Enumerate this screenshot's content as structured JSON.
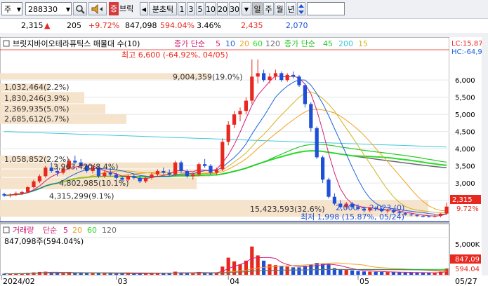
{
  "toolbar": {
    "market_label": "주",
    "code": "288330",
    "search_icon": "search-icon",
    "speaker_icon": "speaker-icon",
    "tags": {
      "jeung": "증",
      "brick": "브릭"
    },
    "minute_tick_label": "분초틱",
    "periods": [
      "1",
      "3",
      "5",
      "10",
      "20",
      "30"
    ],
    "dropdown_icon": "chevron-down-icon",
    "day_label": "일",
    "week_label": "주",
    "month_label": "월",
    "year_label": "년",
    "arrows_icon": "updown-arrows-icon"
  },
  "quote": {
    "price": "2,315",
    "change_arrow": "▲",
    "change": "205",
    "change_pct": "+9.72%",
    "volume": "847,098",
    "volume_ratio": "594.04%",
    "turnover_pct": "3.46%",
    "high": "2,435",
    "low": "2,070"
  },
  "legend": {
    "title": "브릿지바이오테라퓨틱스 매물대 수(10)",
    "ma_label": "종가 단순",
    "ma_periods": [
      "5",
      "10",
      "20",
      "60",
      "120"
    ],
    "ma_label2": "종가 단순",
    "ma_periods2": [
      "45",
      "200",
      "15"
    ],
    "lc_label": "LC:15,87",
    "hc_label": "HC:-64,9"
  },
  "annotations": {
    "high": "최고 6,600 (-64.92%, 04/05)",
    "low": "최저 1,998 (15.87%, 05/24)",
    "range": "2,000 ~ 2,023 (0)",
    "current_price_tag": "2,315",
    "current_pct_tag": "9.72%",
    "volume_tag": "847,09",
    "volume_pct_tag": "594.04"
  },
  "volume_profile": [
    {
      "label": "9,004,359(19.0%)"
    },
    {
      "label": "1,032,464(2.2%)"
    },
    {
      "label": "1,830,246(3.9%)"
    },
    {
      "label": "2,369,935(5.0%)"
    },
    {
      "label": "2,685,612(5.7%)"
    },
    {
      "label": "1,058,852(2.2%)"
    },
    {
      "label": "3,963,420(8.4%)"
    },
    {
      "label": "4,802,985(10.1%)"
    },
    {
      "label": "4,315,299(9.1%)"
    },
    {
      "label": "15,423,593(32.6%)"
    }
  ],
  "price_axis": [
    "6,000",
    "5,500",
    "5,000",
    "4,500",
    "4,000",
    "3,500",
    "3,000",
    "2,500"
  ],
  "volume_pane": {
    "title": "거래량",
    "ma_label": "단순",
    "ma_periods": [
      "5",
      "20",
      "60",
      "120"
    ],
    "current": "847,098주(594.04%)",
    "axis": [
      "5,000K"
    ]
  },
  "date_axis": [
    "2024/02",
    "03",
    "04",
    "05",
    "05/27"
  ],
  "colors": {
    "up": "#e8281e",
    "down": "#1e4fd8",
    "ma5": "#d21e78",
    "ma10": "#1e64dc",
    "ma20": "#f0a01e",
    "ma60": "#2adc2a",
    "ma120": "#6a6a6a",
    "ma45": "#28c828",
    "ma200": "#3cc8dc",
    "ma15": "#d2b41e",
    "profile": "#f5e2c8"
  },
  "chart_data": {
    "type": "candlestick",
    "dates": [
      "02/01",
      "02/02",
      "02/05",
      "02/06",
      "02/07",
      "02/08",
      "02/13",
      "02/14",
      "02/15",
      "02/16",
      "02/19",
      "02/20",
      "02/21",
      "02/22",
      "02/23",
      "02/26",
      "02/27",
      "02/28",
      "02/29",
      "03/04",
      "03/05",
      "03/06",
      "03/07",
      "03/08",
      "03/11",
      "03/12",
      "03/13",
      "03/14",
      "03/15",
      "03/18",
      "03/19",
      "03/20",
      "03/21",
      "03/22",
      "03/25",
      "03/26",
      "03/27",
      "03/28",
      "03/29",
      "04/01",
      "04/02",
      "04/03",
      "04/04",
      "04/05",
      "04/08",
      "04/09",
      "04/11",
      "04/12",
      "04/15",
      "04/16",
      "04/17",
      "04/18",
      "04/19",
      "04/22",
      "04/23",
      "04/24",
      "04/25",
      "04/26",
      "04/29",
      "04/30",
      "05/02",
      "05/03",
      "05/07",
      "05/08",
      "05/09",
      "05/10",
      "05/13",
      "05/14",
      "05/16",
      "05/17",
      "05/20",
      "05/21",
      "05/22",
      "05/23",
      "05/24",
      "05/27"
    ],
    "ohlc": [
      [
        2680,
        2720,
        2600,
        2640
      ],
      [
        2640,
        2700,
        2580,
        2660
      ],
      [
        2660,
        2750,
        2620,
        2700
      ],
      [
        2700,
        2780,
        2650,
        2740
      ],
      [
        2740,
        2900,
        2700,
        2880
      ],
      [
        2880,
        3100,
        2850,
        3050
      ],
      [
        3050,
        3250,
        3000,
        3200
      ],
      [
        3200,
        3500,
        3150,
        3450
      ],
      [
        3450,
        3600,
        3300,
        3350
      ],
      [
        3350,
        3500,
        3200,
        3300
      ],
      [
        3300,
        3480,
        3250,
        3420
      ],
      [
        3420,
        3700,
        3380,
        3650
      ],
      [
        3650,
        3800,
        3550,
        3600
      ],
      [
        3600,
        3700,
        3450,
        3500
      ],
      [
        3500,
        3550,
        3300,
        3350
      ],
      [
        3350,
        3500,
        3280,
        3450
      ],
      [
        3450,
        3480,
        3150,
        3200
      ],
      [
        3200,
        3350,
        3150,
        3300
      ],
      [
        3300,
        3420,
        3200,
        3250
      ],
      [
        3250,
        3300,
        3100,
        3150
      ],
      [
        3150,
        3200,
        3050,
        3100
      ],
      [
        3100,
        3250,
        3050,
        3200
      ],
      [
        3200,
        3280,
        3100,
        3150
      ],
      [
        3150,
        3200,
        3000,
        3050
      ],
      [
        3050,
        3180,
        3000,
        3150
      ],
      [
        3150,
        3300,
        3100,
        3250
      ],
      [
        3250,
        3400,
        3200,
        3350
      ],
      [
        3350,
        3450,
        3250,
        3300
      ],
      [
        3300,
        3400,
        3200,
        3250
      ],
      [
        3250,
        3650,
        3200,
        3600
      ],
      [
        3600,
        3650,
        3300,
        3350
      ],
      [
        3350,
        3400,
        3150,
        3200
      ],
      [
        3200,
        3300,
        3100,
        3250
      ],
      [
        3250,
        3600,
        3200,
        3550
      ],
      [
        3550,
        3700,
        3450,
        3500
      ],
      [
        3500,
        3550,
        3250,
        3300
      ],
      [
        3300,
        3450,
        3250,
        3400
      ],
      [
        3400,
        4300,
        3350,
        4200
      ],
      [
        4200,
        4800,
        4100,
        4700
      ],
      [
        4700,
        5100,
        4600,
        5000
      ],
      [
        5000,
        5200,
        4800,
        5100
      ],
      [
        5100,
        5500,
        5000,
        5400
      ],
      [
        5400,
        6600,
        5300,
        6100
      ],
      [
        6100,
        6600,
        5900,
        6200
      ],
      [
        6200,
        6300,
        5950,
        6000
      ],
      [
        6000,
        6200,
        5900,
        6100
      ],
      [
        6100,
        6300,
        6000,
        6200
      ],
      [
        6200,
        6250,
        5950,
        6000
      ],
      [
        6000,
        6200,
        5950,
        6150
      ],
      [
        6150,
        6250,
        6050,
        6100
      ],
      [
        6100,
        6150,
        5800,
        5850
      ],
      [
        5850,
        5900,
        5200,
        5300
      ],
      [
        5300,
        5350,
        4500,
        4600
      ],
      [
        4600,
        4650,
        3700,
        3750
      ],
      [
        3750,
        3800,
        3000,
        3100
      ],
      [
        3100,
        3150,
        2550,
        2600
      ],
      [
        2600,
        2700,
        2350,
        2400
      ],
      [
        2400,
        2500,
        2250,
        2300
      ],
      [
        2300,
        2450,
        2250,
        2400
      ],
      [
        2400,
        2450,
        2250,
        2300
      ],
      [
        2300,
        2380,
        2200,
        2250
      ],
      [
        2250,
        2320,
        2150,
        2200
      ],
      [
        2200,
        2300,
        2150,
        2280
      ],
      [
        2280,
        2320,
        2200,
        2250
      ],
      [
        2250,
        2280,
        2150,
        2180
      ],
      [
        2180,
        2250,
        2130,
        2200
      ],
      [
        2200,
        2240,
        2120,
        2150
      ],
      [
        2150,
        2200,
        2080,
        2120
      ],
      [
        2120,
        2150,
        2050,
        2080
      ],
      [
        2080,
        2120,
        2030,
        2060
      ],
      [
        2060,
        2090,
        2010,
        2040
      ],
      [
        2040,
        2070,
        2000,
        2030
      ],
      [
        2030,
        2060,
        1998,
        2020
      ],
      [
        2020,
        2080,
        1998,
        2050
      ],
      [
        2050,
        2120,
        2000,
        2110
      ],
      [
        2110,
        2435,
        2070,
        2315
      ]
    ],
    "volume": [
      150,
      140,
      160,
      170,
      260,
      320,
      380,
      420,
      300,
      260,
      240,
      380,
      300,
      260,
      220,
      200,
      240,
      200,
      180,
      170,
      160,
      190,
      170,
      160,
      180,
      220,
      240,
      210,
      200,
      420,
      300,
      240,
      220,
      380,
      300,
      260,
      240,
      1100,
      2300,
      1800,
      1400,
      1900,
      3800,
      2600,
      1900,
      1400,
      1300,
      1200,
      1100,
      1000,
      1000,
      1200,
      1400,
      1600,
      1500,
      1400,
      900,
      700,
      650,
      600,
      500,
      450,
      420,
      400,
      380,
      360,
      340,
      320,
      300,
      290,
      280,
      270,
      260,
      280,
      400,
      847
    ],
    "ylim": [
      1900,
      6800
    ],
    "volume_ylim": [
      0,
      6500
    ]
  }
}
